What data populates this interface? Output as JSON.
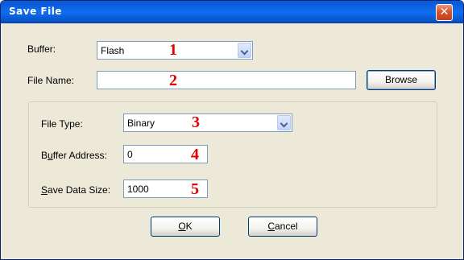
{
  "window": {
    "title": "Save File",
    "close_glyph": "✕"
  },
  "fields": {
    "buffer": {
      "label": "Buffer:",
      "value": "Flash"
    },
    "file_name": {
      "label": "File Name:",
      "value": "",
      "browse_label": "Browse"
    },
    "file_type": {
      "label": "File Type:",
      "value": "Binary"
    },
    "buffer_address": {
      "label_pre": "B",
      "label_mnemonic": "u",
      "label_post": "ffer Address:",
      "value": "0"
    },
    "save_data_size": {
      "label_mnemonic": "S",
      "label_post": "ave Data Size:",
      "value": "1000"
    }
  },
  "annotations": [
    "1",
    "2",
    "3",
    "4",
    "5"
  ],
  "buttons": {
    "ok": {
      "mnemonic": "O",
      "rest": "K"
    },
    "cancel": {
      "mnemonic": "C",
      "rest": "ancel"
    }
  },
  "icons": {
    "dropdown": "chevron-down-icon",
    "close": "close-icon"
  }
}
